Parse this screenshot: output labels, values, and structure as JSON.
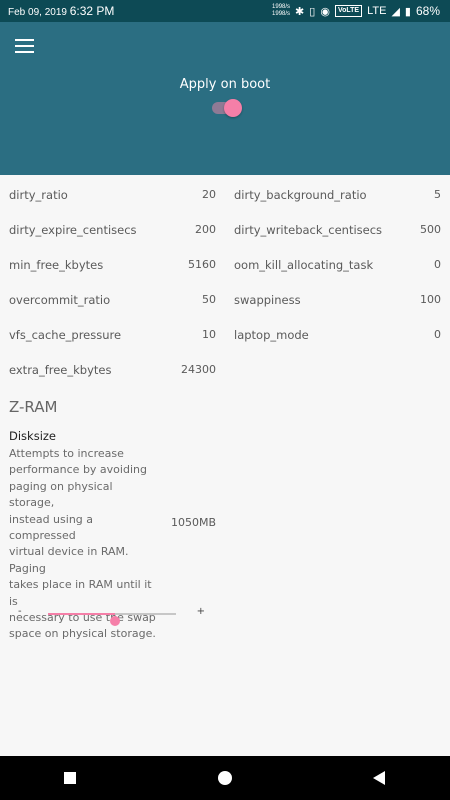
{
  "status_bar": {
    "date": "Feb 09, 2019",
    "time": "6:32 PM",
    "speed_up": "1998/s",
    "speed_down": "1998/s",
    "volte": "VoLTE",
    "network": "LTE",
    "battery": "68%"
  },
  "header": {
    "apply_on_boot_label": "Apply on boot",
    "apply_on_boot_enabled": true
  },
  "settings": {
    "left": [
      {
        "name": "dirty_ratio",
        "value": "20"
      },
      {
        "name": "dirty_expire_centisecs",
        "value": "200"
      },
      {
        "name": "min_free_kbytes",
        "value": "5160"
      },
      {
        "name": "overcommit_ratio",
        "value": "50"
      },
      {
        "name": "vfs_cache_pressure",
        "value": "10"
      },
      {
        "name": "extra_free_kbytes",
        "value": "24300"
      }
    ],
    "right": [
      {
        "name": "dirty_background_ratio",
        "value": "5"
      },
      {
        "name": "dirty_writeback_centisecs",
        "value": "500"
      },
      {
        "name": "oom_kill_allocating_task",
        "value": "0"
      },
      {
        "name": "swappiness",
        "value": "100"
      },
      {
        "name": "laptop_mode",
        "value": "0"
      }
    ]
  },
  "zram": {
    "section_title": "Z-RAM",
    "disksize_title": "Disksize",
    "disksize_desc_lines": [
      "Attempts to increase",
      "performance by avoiding",
      "paging on physical storage,",
      "instead using a compressed",
      "virtual device in RAM. Paging",
      "takes place in RAM until it is",
      "necessary to use the swap",
      "space on physical storage."
    ],
    "disksize_value": "1050MB",
    "slider_minus": "-",
    "slider_plus": "+",
    "slider_fraction": 0.52
  },
  "colors": {
    "appbar": "#2b6e82",
    "status_bar": "#0d4a55",
    "accent": "#f57fa8"
  }
}
